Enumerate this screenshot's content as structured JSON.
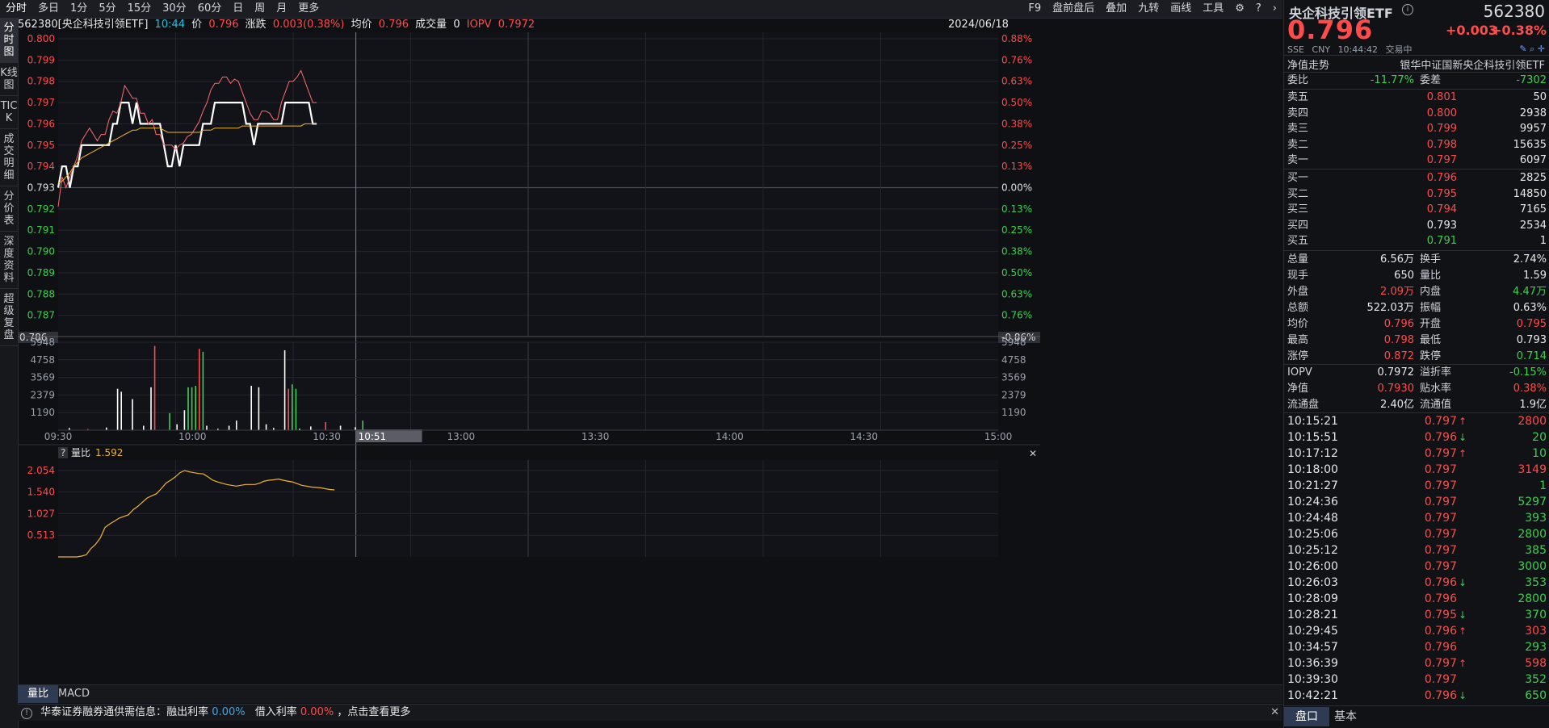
{
  "toolbar": {
    "periods": [
      "分时",
      "多日",
      "1分",
      "5分",
      "15分",
      "30分",
      "60分",
      "日",
      "周",
      "月",
      "更多"
    ],
    "right_items": [
      "F9",
      "盘前盘后",
      "叠加",
      "九转",
      "画线",
      "工具"
    ]
  },
  "left_tabs": [
    "分时图",
    "K线图",
    "TICK",
    "成交明细",
    "分价表",
    "深度资料",
    "超级复盘"
  ],
  "info": {
    "code_name": "562380[央企科技引领ETF]",
    "time": "10:44",
    "price_label": "价",
    "price": "0.796",
    "change_label": "涨跌",
    "change": "0.003(0.38%)",
    "avg_label": "均价",
    "avg": "0.796",
    "vol_label": "成交量",
    "vol": "0",
    "iopv_label": "IOPV",
    "iopv": "0.7972",
    "date": "2024/06/18"
  },
  "chart_data": [
    {
      "type": "line",
      "name": "intraday",
      "x_ticks": [
        "09:30",
        "10:00",
        "10:30",
        "13:00",
        "13:30",
        "14:00",
        "14:30",
        "15:00"
      ],
      "y_left_ticks": [
        "0.800",
        "0.799",
        "0.798",
        "0.797",
        "0.796",
        "0.795",
        "0.794",
        "0.793",
        "0.792",
        "0.791",
        "0.790",
        "0.789",
        "0.788",
        "0.787"
      ],
      "y_left_bottom": "0.786",
      "y_right_ticks": [
        "0.88%",
        "0.76%",
        "0.63%",
        "0.50%",
        "0.38%",
        "0.25%",
        "0.13%",
        "0.00%",
        "0.13%",
        "0.25%",
        "0.38%",
        "0.50%",
        "0.63%",
        "0.76%"
      ],
      "y_right_bottom": "-0.86%",
      "ylim": [
        0.786,
        0.8
      ],
      "prev_close": 0.793,
      "crosshair_time": "10:51",
      "series": [
        {
          "color": "#ffffff",
          "values": [
            0.793,
            0.794,
            0.794,
            0.793,
            0.794,
            0.794,
            0.795,
            0.795,
            0.795,
            0.795,
            0.795,
            0.795,
            0.795,
            0.795,
            0.796,
            0.796,
            0.797,
            0.797,
            0.797,
            0.796,
            0.797,
            0.796,
            0.796,
            0.796,
            0.796,
            0.796,
            0.796,
            0.795,
            0.794,
            0.794,
            0.795,
            0.794,
            0.795,
            0.795,
            0.795,
            0.795,
            0.795,
            0.796,
            0.796,
            0.796,
            0.797,
            0.797,
            0.797,
            0.797,
            0.797,
            0.797,
            0.797,
            0.797,
            0.796,
            0.796,
            0.795,
            0.796,
            0.796,
            0.796,
            0.796,
            0.796,
            0.796,
            0.796,
            0.797,
            0.797,
            0.797,
            0.797,
            0.797,
            0.797,
            0.797,
            0.796,
            0.796
          ]
        },
        {
          "color": "#ff6b6b",
          "values": [
            0.7921,
            0.7935,
            0.793,
            0.7935,
            0.794,
            0.7945,
            0.7952,
            0.7955,
            0.7958,
            0.7955,
            0.7952,
            0.7955,
            0.7955,
            0.7962,
            0.7966,
            0.7965,
            0.797,
            0.7978,
            0.7975,
            0.7972,
            0.7972,
            0.7965,
            0.7965,
            0.796,
            0.7962,
            0.7955,
            0.7955,
            0.795,
            0.795,
            0.795,
            0.7948,
            0.795,
            0.7951,
            0.7954,
            0.7955,
            0.7958,
            0.7961,
            0.7966,
            0.797,
            0.7976,
            0.7979,
            0.7979,
            0.7982,
            0.7982,
            0.7979,
            0.7981,
            0.798,
            0.7975,
            0.797,
            0.7965,
            0.7962,
            0.7962,
            0.7966,
            0.7966,
            0.7965,
            0.7962,
            0.7962,
            0.797,
            0.7975,
            0.798,
            0.798,
            0.7982,
            0.7985,
            0.798,
            0.7975,
            0.797,
            0.797
          ]
        },
        {
          "color": "#f0b429",
          "values": [
            0.7932,
            0.7933,
            0.7935,
            0.7937,
            0.794,
            0.7942,
            0.7944,
            0.7945,
            0.7946,
            0.7947,
            0.7948,
            0.7949,
            0.795,
            0.7951,
            0.7952,
            0.7953,
            0.7954,
            0.7955,
            0.7956,
            0.7957,
            0.7957,
            0.7958,
            0.7958,
            0.7958,
            0.7958,
            0.7958,
            0.7958,
            0.7957,
            0.7956,
            0.7956,
            0.7956,
            0.7956,
            0.7956,
            0.7956,
            0.7956,
            0.7956,
            0.7956,
            0.7957,
            0.7957,
            0.7957,
            0.7958,
            0.7958,
            0.7958,
            0.7958,
            0.7958,
            0.7958,
            0.7958,
            0.7959,
            0.7959,
            0.7959,
            0.7959,
            0.7959,
            0.7959,
            0.7959,
            0.7959,
            0.7959,
            0.7959,
            0.7959,
            0.7959,
            0.7959,
            0.7959,
            0.7959,
            0.7959,
            0.796,
            0.796,
            0.796,
            0.796
          ]
        }
      ]
    },
    {
      "type": "bar",
      "name": "volume",
      "y_ticks": [
        "5948",
        "4758",
        "3569",
        "2379",
        "1190"
      ],
      "ylim": [
        0,
        5948
      ],
      "bars": [
        {
          "i": 3,
          "v": 150,
          "c": "#ffffff"
        },
        {
          "i": 8,
          "v": 80,
          "c": "#ff4b4b"
        },
        {
          "i": 13,
          "v": 180,
          "c": "#ffffff"
        },
        {
          "i": 16,
          "v": 2800,
          "c": "#ffffff"
        },
        {
          "i": 17,
          "v": 2600,
          "c": "#ffffff"
        },
        {
          "i": 20,
          "v": 2100,
          "c": "#ffffff"
        },
        {
          "i": 23,
          "v": 300,
          "c": "#ffffff"
        },
        {
          "i": 25,
          "v": 2900,
          "c": "#ffffff"
        },
        {
          "i": 26,
          "v": 5700,
          "c": "#ff4b4b"
        },
        {
          "i": 30,
          "v": 1150,
          "c": "#3dcf52"
        },
        {
          "i": 32,
          "v": 400,
          "c": "#ffffff"
        },
        {
          "i": 34,
          "v": 1350,
          "c": "#ffffff"
        },
        {
          "i": 35,
          "v": 2900,
          "c": "#3dcf52"
        },
        {
          "i": 36,
          "v": 2900,
          "c": "#3dcf52"
        },
        {
          "i": 37,
          "v": 3000,
          "c": "#3dcf52"
        },
        {
          "i": 38,
          "v": 5500,
          "c": "#ff4b4b"
        },
        {
          "i": 39,
          "v": 5300,
          "c": "#3dcf52"
        },
        {
          "i": 40,
          "v": 300,
          "c": "#ffffff"
        },
        {
          "i": 43,
          "v": 100,
          "c": "#ffffff"
        },
        {
          "i": 46,
          "v": 300,
          "c": "#ffffff"
        },
        {
          "i": 48,
          "v": 650,
          "c": "#ffffff"
        },
        {
          "i": 52,
          "v": 3000,
          "c": "#ffffff"
        },
        {
          "i": 54,
          "v": 2900,
          "c": "#ffffff"
        },
        {
          "i": 56,
          "v": 400,
          "c": "#ffffff"
        },
        {
          "i": 58,
          "v": 150,
          "c": "#ffffff"
        },
        {
          "i": 61,
          "v": 5400,
          "c": "#ffffff"
        },
        {
          "i": 62,
          "v": 2800,
          "c": "#ff4b4b"
        },
        {
          "i": 63,
          "v": 3100,
          "c": "#3dcf52"
        },
        {
          "i": 64,
          "v": 2800,
          "c": "#3dcf52"
        },
        {
          "i": 65,
          "v": 100,
          "c": "#ffffff"
        },
        {
          "i": 68,
          "v": 250,
          "c": "#ffffff"
        },
        {
          "i": 72,
          "v": 550,
          "c": "#ff4b4b"
        },
        {
          "i": 76,
          "v": 300,
          "c": "#ffffff"
        },
        {
          "i": 80,
          "v": 200,
          "c": "#ffffff"
        },
        {
          "i": 82,
          "v": 650,
          "c": "#3dcf52"
        }
      ]
    },
    {
      "type": "line",
      "name": "volume-ratio",
      "y_ticks": [
        "2.054",
        "1.540",
        "1.027",
        "0.513"
      ],
      "ylim": [
        0,
        2.3
      ],
      "series": [
        {
          "name": "量比",
          "color": "#f0b429",
          "values": [
            0.0,
            0.0,
            0.0,
            0.0,
            0.0,
            0.02,
            0.05,
            0.2,
            0.3,
            0.45,
            0.7,
            0.78,
            0.85,
            0.92,
            0.96,
            1.0,
            1.12,
            1.2,
            1.3,
            1.4,
            1.45,
            1.5,
            1.62,
            1.75,
            1.82,
            1.9,
            2.0,
            2.05,
            2.02,
            2.0,
            1.98,
            1.97,
            1.9,
            1.82,
            1.78,
            1.75,
            1.72,
            1.7,
            1.68,
            1.7,
            1.72,
            1.72,
            1.72,
            1.75,
            1.8,
            1.82,
            1.83,
            1.85,
            1.82,
            1.8,
            1.78,
            1.74,
            1.7,
            1.68,
            1.66,
            1.65,
            1.64,
            1.62,
            1.6,
            1.59
          ]
        }
      ],
      "label": "量比",
      "value": "1.592"
    }
  ],
  "subtabs": [
    "量比",
    "MACD"
  ],
  "bottom_bar": {
    "msg1": "华泰证券融券通供需信息：融出利率",
    "rate1": "0.00%",
    "msg2": "借入利率",
    "rate2": "0.00%",
    "msg3": "，点击查看更多"
  },
  "panel": {
    "title": "央企科技引领ETF",
    "code": "562380",
    "price": "0.796",
    "change": "+0.003",
    "change_pct": "+0.38%",
    "exchange": "SSE",
    "currency": "CNY",
    "time": "10:44:42",
    "status": "交易中",
    "nav_trend": "净值走势",
    "fund_name": "银华中证国新央企科技引领ETF",
    "weibi_label": "委比",
    "weibi": "-11.77%",
    "weicha_label": "委差",
    "weicha": "-7302",
    "asks": [
      {
        "label": "卖五",
        "price": "0.801",
        "vol": "50"
      },
      {
        "label": "卖四",
        "price": "0.800",
        "vol": "2938"
      },
      {
        "label": "卖三",
        "price": "0.799",
        "vol": "9957"
      },
      {
        "label": "卖二",
        "price": "0.798",
        "vol": "15635"
      },
      {
        "label": "卖一",
        "price": "0.797",
        "vol": "6097"
      }
    ],
    "bids": [
      {
        "label": "买一",
        "price": "0.796",
        "vol": "2825"
      },
      {
        "label": "买二",
        "price": "0.795",
        "vol": "14850"
      },
      {
        "label": "买三",
        "price": "0.794",
        "vol": "7165"
      },
      {
        "label": "买四",
        "price": "0.793",
        "vol": "2534"
      },
      {
        "label": "买五",
        "price": "0.791",
        "vol": "1"
      }
    ],
    "stats": [
      {
        "l1": "总量",
        "v1": "6.56万",
        "c1": "white",
        "l2": "换手",
        "v2": "2.74%",
        "c2": "white"
      },
      {
        "l1": "现手",
        "v1": "650",
        "c1": "white",
        "l2": "量比",
        "v2": "1.59",
        "c2": "white"
      },
      {
        "l1": "外盘",
        "v1": "2.09万",
        "c1": "red",
        "l2": "内盘",
        "v2": "4.47万",
        "c2": "green"
      },
      {
        "l1": "总额",
        "v1": "522.03万",
        "c1": "white",
        "l2": "振幅",
        "v2": "0.63%",
        "c2": "white"
      },
      {
        "l1": "均价",
        "v1": "0.796",
        "c1": "red",
        "l2": "开盘",
        "v2": "0.795",
        "c2": "red"
      },
      {
        "l1": "最高",
        "v1": "0.798",
        "c1": "red",
        "l2": "最低",
        "v2": "0.793",
        "c2": "white"
      },
      {
        "l1": "涨停",
        "v1": "0.872",
        "c1": "red",
        "l2": "跌停",
        "v2": "0.714",
        "c2": "green"
      }
    ],
    "stats2": [
      {
        "l1": "IOPV",
        "v1": "0.7972",
        "c1": "white",
        "l2": "溢折率",
        "v2": "-0.15%",
        "c2": "green"
      },
      {
        "l1": "净值",
        "v1": "0.7930",
        "c1": "red",
        "l2": "贴水率",
        "v2": "0.38%",
        "c2": "red"
      },
      {
        "l1": "流通盘",
        "v1": "2.40亿",
        "c1": "white",
        "l2": "流通值",
        "v2": "1.9亿",
        "c2": "white"
      }
    ],
    "trades": [
      {
        "t": "10:15:21",
        "p": "0.797",
        "pc": "red",
        "d": "up",
        "v": "2800",
        "vc": "red"
      },
      {
        "t": "10:15:51",
        "p": "0.796",
        "pc": "red",
        "d": "down",
        "v": "20",
        "vc": "green"
      },
      {
        "t": "10:17:12",
        "p": "0.797",
        "pc": "red",
        "d": "up",
        "v": "10",
        "vc": "green"
      },
      {
        "t": "10:18:00",
        "p": "0.797",
        "pc": "red",
        "d": "",
        "v": "3149",
        "vc": "red"
      },
      {
        "t": "10:21:27",
        "p": "0.797",
        "pc": "red",
        "d": "",
        "v": "1",
        "vc": "green"
      },
      {
        "t": "10:24:36",
        "p": "0.797",
        "pc": "red",
        "d": "",
        "v": "5297",
        "vc": "green"
      },
      {
        "t": "10:24:48",
        "p": "0.797",
        "pc": "red",
        "d": "",
        "v": "393",
        "vc": "green"
      },
      {
        "t": "10:25:06",
        "p": "0.797",
        "pc": "red",
        "d": "",
        "v": "2800",
        "vc": "green"
      },
      {
        "t": "10:25:12",
        "p": "0.797",
        "pc": "red",
        "d": "",
        "v": "385",
        "vc": "green"
      },
      {
        "t": "10:26:00",
        "p": "0.797",
        "pc": "red",
        "d": "",
        "v": "3000",
        "vc": "green"
      },
      {
        "t": "10:26:03",
        "p": "0.796",
        "pc": "red",
        "d": "down",
        "v": "353",
        "vc": "green"
      },
      {
        "t": "10:28:09",
        "p": "0.796",
        "pc": "red",
        "d": "",
        "v": "2800",
        "vc": "green"
      },
      {
        "t": "10:28:21",
        "p": "0.795",
        "pc": "red",
        "d": "down",
        "v": "370",
        "vc": "green"
      },
      {
        "t": "10:29:45",
        "p": "0.796",
        "pc": "red",
        "d": "up",
        "v": "303",
        "vc": "red"
      },
      {
        "t": "10:34:57",
        "p": "0.796",
        "pc": "red",
        "d": "",
        "v": "293",
        "vc": "green"
      },
      {
        "t": "10:36:39",
        "p": "0.797",
        "pc": "red",
        "d": "up",
        "v": "598",
        "vc": "red"
      },
      {
        "t": "10:39:30",
        "p": "0.797",
        "pc": "red",
        "d": "",
        "v": "352",
        "vc": "green"
      },
      {
        "t": "10:42:21",
        "p": "0.796",
        "pc": "red",
        "d": "down",
        "v": "650",
        "vc": "green"
      }
    ],
    "tabs": [
      "盘口",
      "基本"
    ]
  }
}
